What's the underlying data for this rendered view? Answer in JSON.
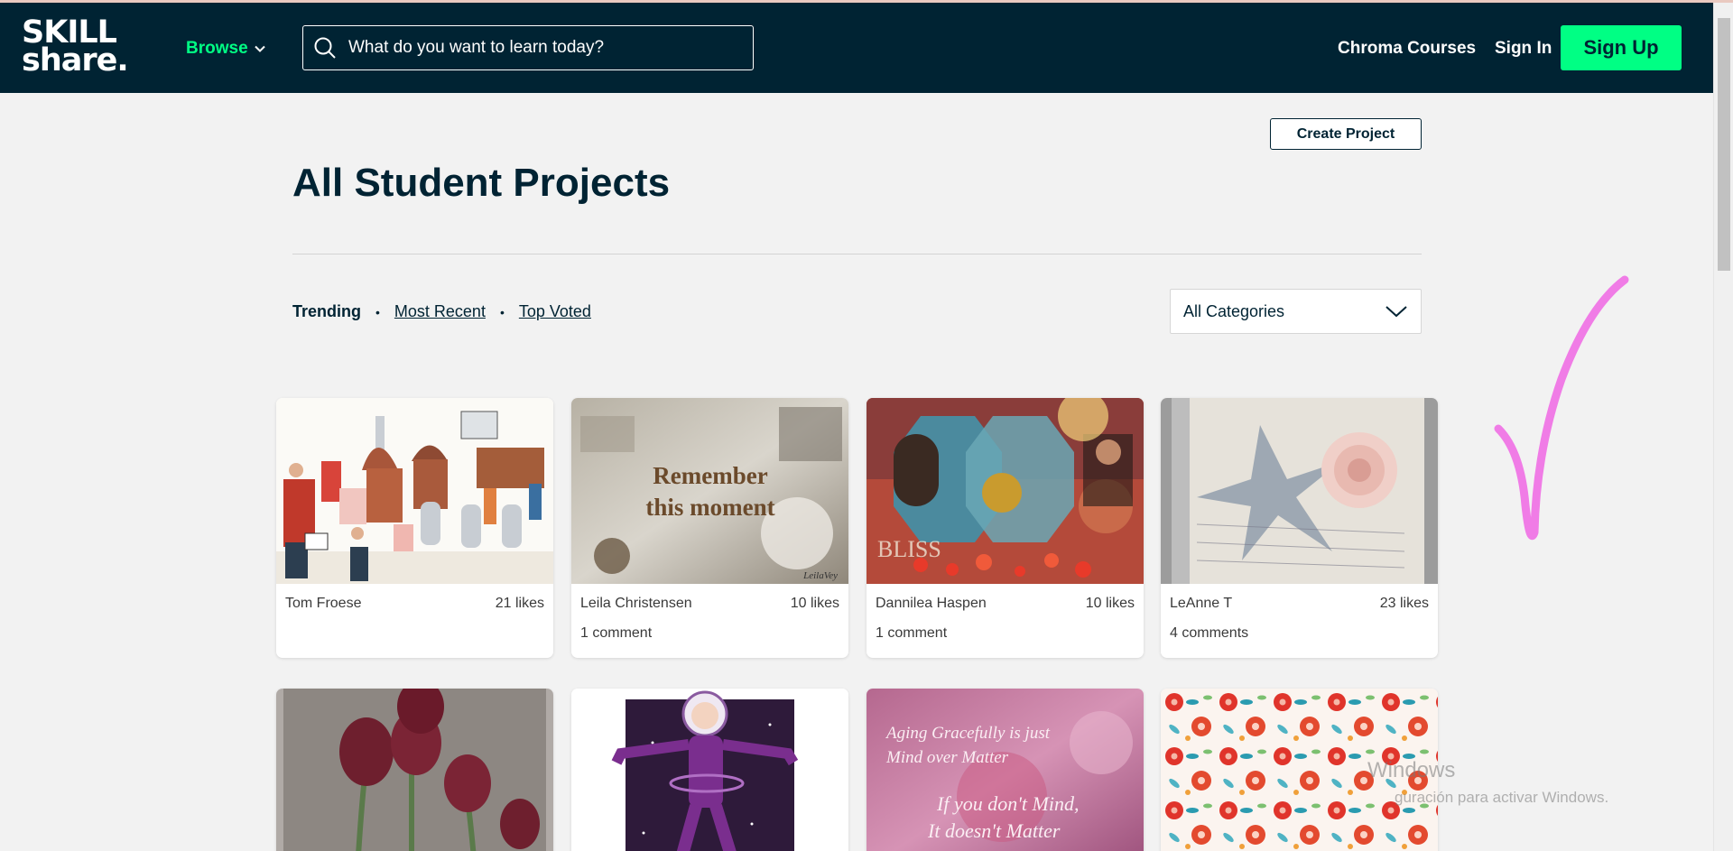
{
  "header": {
    "logo_line1": "SKILL",
    "logo_line2": "share.",
    "browse_label": "Browse",
    "search_placeholder": "What do you want to learn today?",
    "chroma_label": "Chroma Courses",
    "signin_label": "Sign In",
    "signup_label": "Sign Up"
  },
  "page": {
    "create_project_label": "Create Project",
    "title": "All Student Projects"
  },
  "sort": {
    "trending": "Trending",
    "most_recent": "Most Recent",
    "top_voted": "Top Voted",
    "separator": "•"
  },
  "category_select": {
    "selected": "All Categories"
  },
  "projects": [
    {
      "author": "Tom Froese",
      "likes": "21 likes",
      "comments": "",
      "thumb": "brewery illustration"
    },
    {
      "author": "Leila Christensen",
      "likes": "10 likes",
      "comments": "1 comment",
      "thumb_text_1": "Remember",
      "thumb_text_2": "this moment",
      "thumb_signature": "LeilaVey"
    },
    {
      "author": "Dannilea Haspen",
      "likes": "10 likes",
      "comments": "1 comment",
      "thumb_text": "BLISS"
    },
    {
      "author": "LeAnne T",
      "likes": "23 likes",
      "comments": "4 comments",
      "thumb": "rose collage"
    },
    {
      "thumb": "tulips"
    },
    {
      "thumb": "space girl illustration"
    },
    {
      "thumb_text_1": "Aging Gracefully is just",
      "thumb_text_2": "Mind over Matter",
      "thumb_text_3": "If you don't Mind,",
      "thumb_text_4": "It doesn't Matter"
    },
    {
      "thumb": "floral pattern"
    }
  ],
  "os_overlay": {
    "line1": "Windows",
    "line2": "guración para activar Windows."
  },
  "colors": {
    "nav_bg": "#002333",
    "accent_green": "#00ff84",
    "page_bg": "#f2f2f2",
    "annotation_pink": "#f07ce6"
  }
}
